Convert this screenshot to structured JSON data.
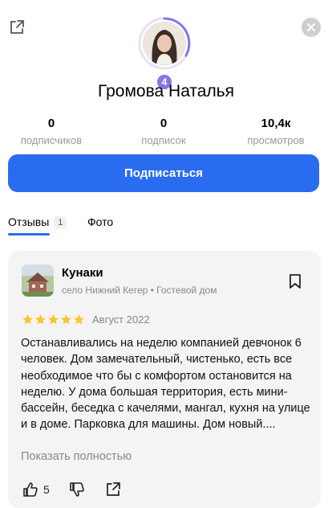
{
  "header": {
    "share_icon": "external-link-icon",
    "close_icon": "close-icon"
  },
  "profile": {
    "name": "Громова Наталья",
    "level": "4",
    "ring_color": "#8a73e6"
  },
  "stats": [
    {
      "value": "0",
      "label": "подписчиков"
    },
    {
      "value": "0",
      "label": "подписок"
    },
    {
      "value": "10,4к",
      "label": "просмотров"
    }
  ],
  "subscribe_button": {
    "label": "Подписаться",
    "color": "#2a6cf0"
  },
  "tabs": [
    {
      "label": "Отзывы",
      "count": "1",
      "active": true
    },
    {
      "label": "Фото",
      "active": false
    }
  ],
  "review": {
    "place_name": "Кунаки",
    "place_meta": "село Нижний Кегер • Гостевой дом",
    "rating": 5,
    "date": "Август 2022",
    "text": "Останавливались на неделю компанией девчонок 6 человек. Дом замечательный, чистенько, есть все необходимое что бы с комфортом остановится на неделю. У дома большая территория, есть мини-бассейн, беседка с качелями, мангал, кухня на улице и в доме. Парковка для машины. Дом новый....",
    "show_more": "Показать полностью",
    "likes": "5",
    "star_color": "#fcc531"
  }
}
